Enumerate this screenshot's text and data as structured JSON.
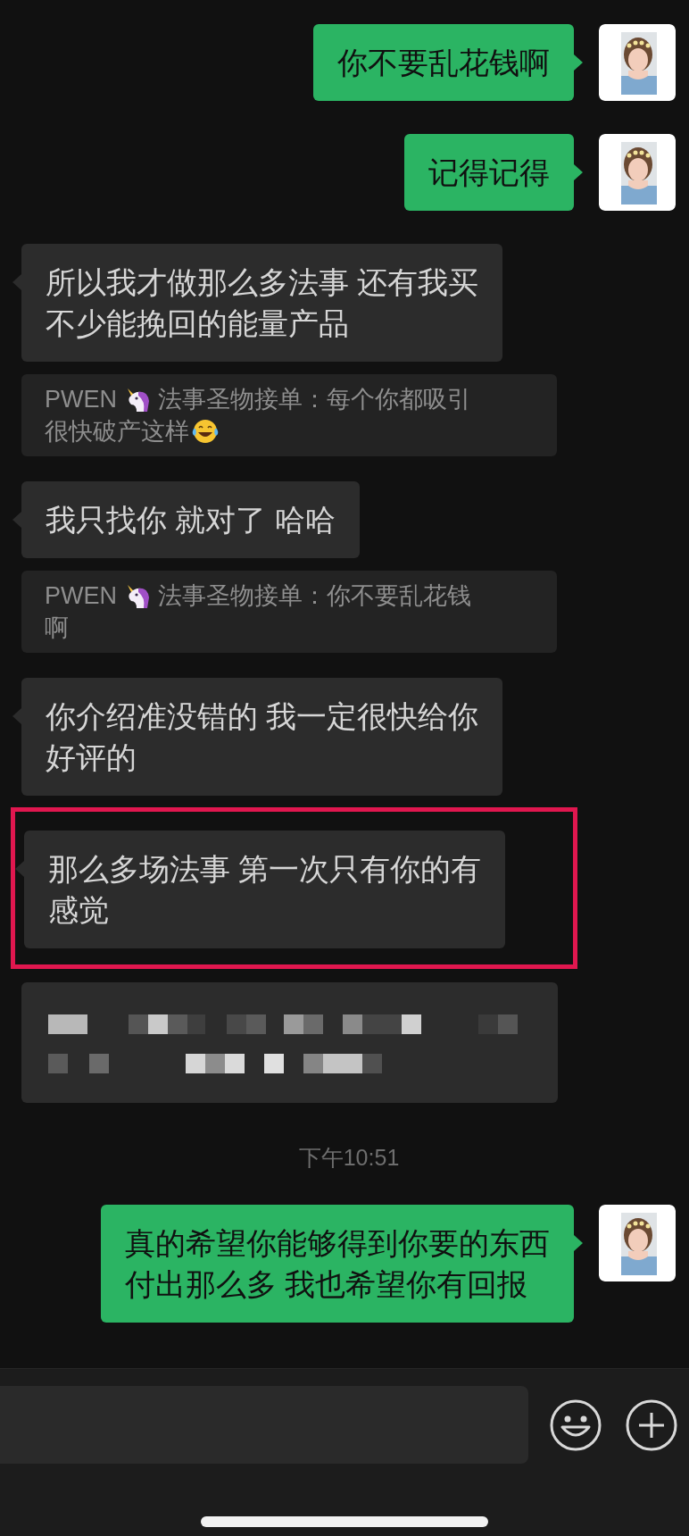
{
  "messages": [
    {
      "kind": "text",
      "outgoing": true,
      "lines": [
        "你不要乱花钱啊"
      ],
      "avatar": {
        "kind": "picture"
      }
    },
    {
      "kind": "text",
      "outgoing": true,
      "lines": [
        "记得记得"
      ],
      "avatar": {
        "kind": "picture"
      }
    },
    {
      "kind": "text",
      "outgoing": false,
      "highlighted": false,
      "lines": [
        "所以我才做那么多法事 还有我买",
        "不少能挽回的能量产品"
      ]
    },
    {
      "kind": "quote",
      "sender": "PWEN",
      "lines": [
        "法事圣物接单：每个你都吸引",
        "很快破产这样"
      ],
      "ends_with_emoji": true
    },
    {
      "kind": "text",
      "outgoing": false,
      "highlighted": false,
      "lines": [
        "我只找你 就对了 哈哈"
      ]
    },
    {
      "kind": "quote",
      "sender": "PWEN",
      "lines": [
        "法事圣物接单：你不要乱花钱",
        "啊"
      ],
      "ends_with_emoji": false
    },
    {
      "kind": "text",
      "outgoing": false,
      "highlighted": false,
      "lines": [
        "你介绍准没错的 我一定很快给你",
        "好评的"
      ]
    },
    {
      "kind": "text",
      "outgoing": false,
      "highlighted": true,
      "lines": [
        "那么多场法事 第一次只有你的有",
        "感觉"
      ]
    },
    {
      "kind": "redacted"
    },
    {
      "kind": "time",
      "text": "下午10:51"
    },
    {
      "kind": "text",
      "outgoing": true,
      "lines": [
        "真的希望你能够得到你要的东西",
        "付出那么多 我也希望你有回报"
      ],
      "avatar": {
        "kind": "picture"
      }
    }
  ]
}
